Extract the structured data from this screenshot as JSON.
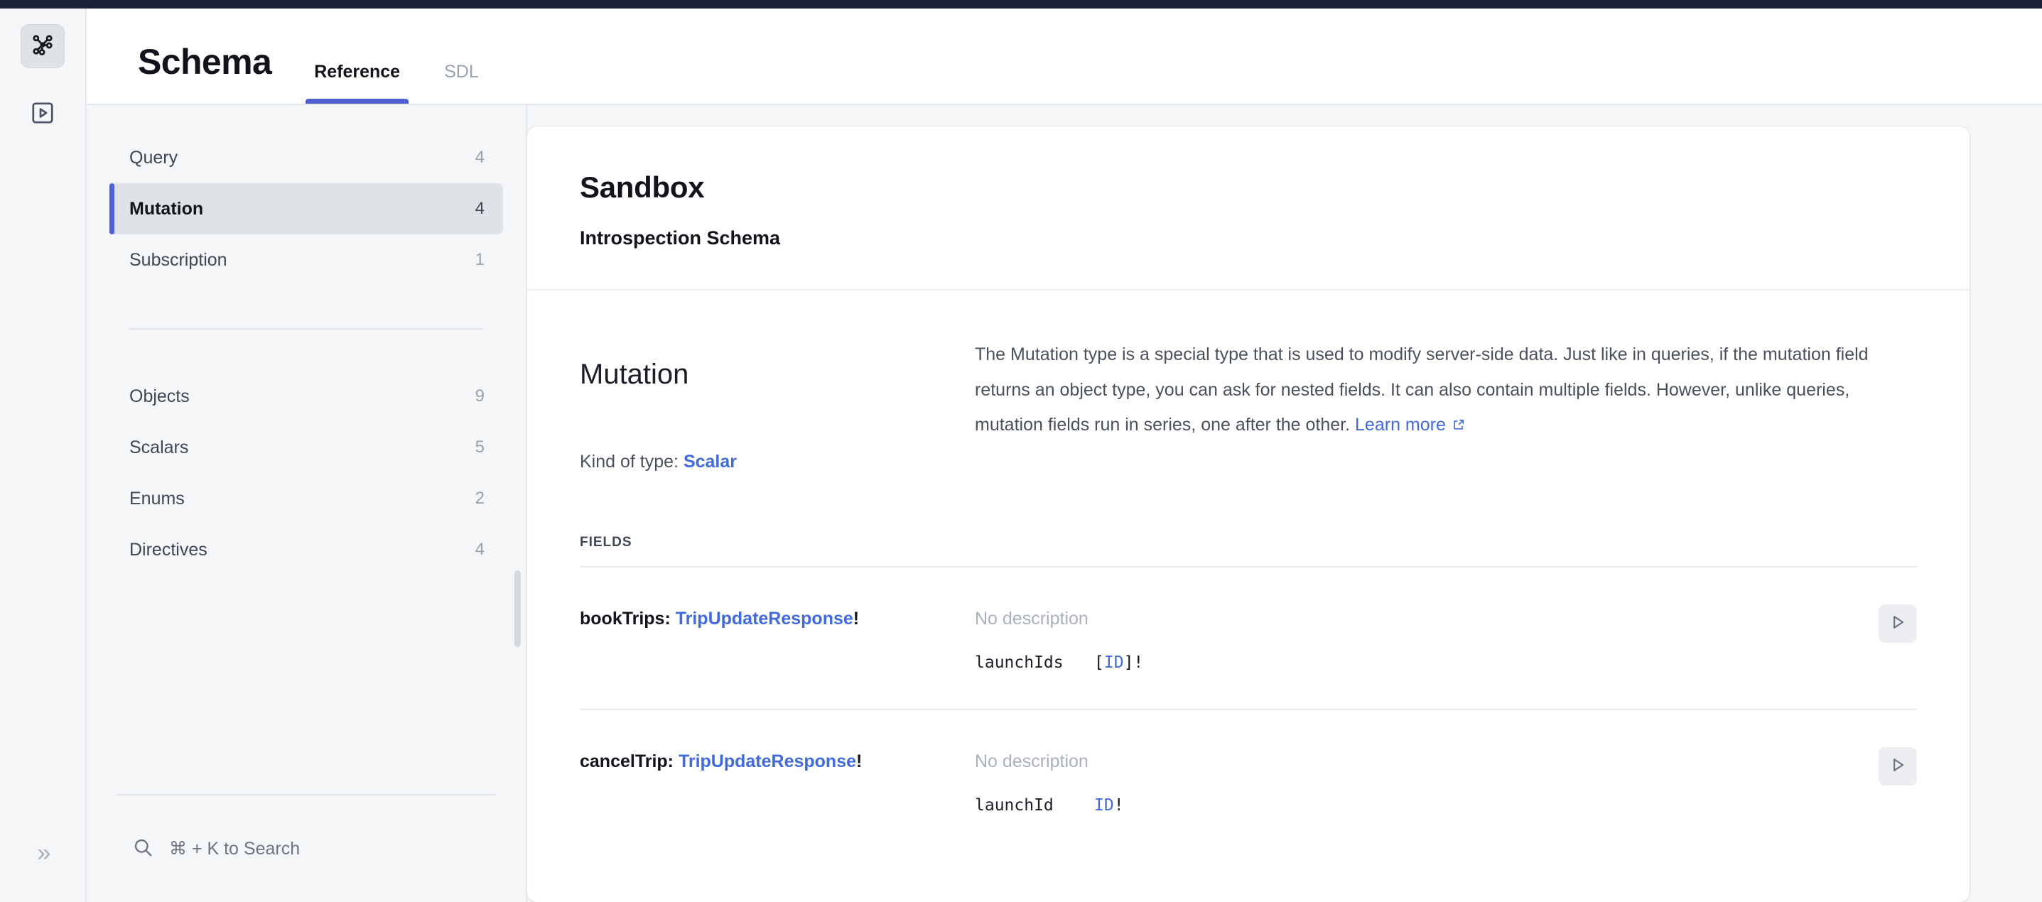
{
  "rail": {
    "items": [
      {
        "name": "schema-icon",
        "label": "Schema",
        "active": true
      },
      {
        "name": "explorer-icon",
        "label": "Explorer",
        "active": false
      }
    ],
    "collapse_label": "»"
  },
  "header": {
    "title": "Schema",
    "tabs": [
      {
        "label": "Reference",
        "active": true
      },
      {
        "label": "SDL",
        "active": false
      }
    ]
  },
  "sidebar": {
    "root_items": [
      {
        "label": "Query",
        "count": "4",
        "selected": false
      },
      {
        "label": "Mutation",
        "count": "4",
        "selected": true
      },
      {
        "label": "Subscription",
        "count": "1",
        "selected": false
      }
    ],
    "type_items": [
      {
        "label": "Objects",
        "count": "9",
        "selected": false
      },
      {
        "label": "Scalars",
        "count": "5",
        "selected": false
      },
      {
        "label": "Enums",
        "count": "2",
        "selected": false
      },
      {
        "label": "Directives",
        "count": "4",
        "selected": false
      }
    ],
    "search": {
      "icon": "search-icon",
      "hint": "⌘ + K to Search"
    }
  },
  "doc": {
    "card_title": "Sandbox",
    "card_subtitle": "Introspection Schema",
    "type_name": "Mutation",
    "kind_prefix": "Kind of type: ",
    "kind_value": "Scalar",
    "description": "The Mutation type is a special type that is used to modify server-side data. Just like in queries, if the mutation field returns an object type, you can ask for nested fields. It can also contain multiple fields. However, unlike queries, mutation fields run in series, one after the other. ",
    "learn_more": "Learn more",
    "fields_label": "FIELDS",
    "fields": [
      {
        "name": "bookTrips: ",
        "return_type": "TripUpdateResponse",
        "non_null": "!",
        "description": "No description",
        "args": [
          {
            "name": "launchIds",
            "type_prefix": "[",
            "type_ref": "ID",
            "type_suffix": "]!"
          }
        ],
        "run_label": "run-field-button"
      },
      {
        "name": "cancelTrip: ",
        "return_type": "TripUpdateResponse",
        "non_null": "!",
        "description": "No description",
        "args": [
          {
            "name": "launchId",
            "type_prefix": "",
            "type_ref": "ID",
            "type_suffix": "!"
          }
        ],
        "run_label": "run-field-button"
      }
    ]
  },
  "colors": {
    "accent": "#5161d1",
    "link": "#4069e5",
    "topbar": "#1b1f38",
    "panel_bg": "#f4f6f8"
  }
}
